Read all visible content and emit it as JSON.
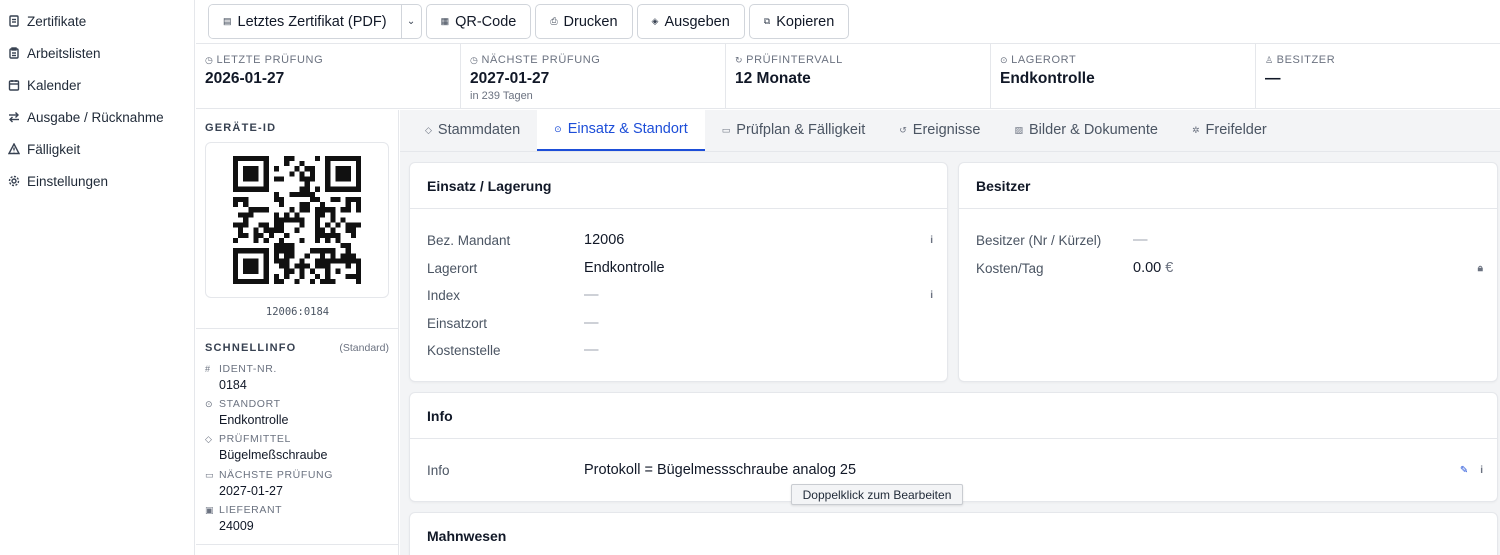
{
  "sidebar": {
    "items": [
      {
        "label": "Zertifikate",
        "icon": "document-icon"
      },
      {
        "label": "Arbeitslisten",
        "icon": "clipboard-icon"
      },
      {
        "label": "Kalender",
        "icon": "calendar-icon"
      },
      {
        "label": "Ausgabe / Rücknahme",
        "icon": "arrows-icon"
      },
      {
        "label": "Fälligkeit",
        "icon": "warning-icon"
      },
      {
        "label": "Einstellungen",
        "icon": "gear-icon"
      }
    ]
  },
  "toolbar": {
    "certificate_label": "Letztes Zertifikat (PDF)",
    "qr_label": "QR-Code",
    "print_label": "Drucken",
    "issue_label": "Ausgeben",
    "copy_label": "Kopieren"
  },
  "stats": [
    {
      "label": "LETZTE PRÜFUNG",
      "value": "2026-01-27",
      "sub": ""
    },
    {
      "label": "NÄCHSTE PRÜFUNG",
      "value": "2027-01-27",
      "sub": "in 239 Tagen"
    },
    {
      "label": "PRÜFINTERVALL",
      "value": "12 Monate",
      "sub": ""
    },
    {
      "label": "LAGERORT",
      "value": "Endkontrolle",
      "sub": ""
    },
    {
      "label": "BESITZER",
      "value": "—",
      "sub": ""
    }
  ],
  "device": {
    "heading": "GERÄTE-ID",
    "qr_text": "12006:0184"
  },
  "quickinfo": {
    "heading": "SCHNELLINFO",
    "mode": "(Standard)",
    "items": [
      {
        "label": "IDENT-NR.",
        "value": "0184",
        "icon": "hash-icon"
      },
      {
        "label": "STANDORT",
        "value": "Endkontrolle",
        "icon": "pin-icon"
      },
      {
        "label": "PRÜFMITTEL",
        "value": "Bügelmeßschraube",
        "icon": "tag-icon"
      },
      {
        "label": "NÄCHSTE PRÜFUNG",
        "value": "2027-01-27",
        "icon": "calendar-icon"
      },
      {
        "label": "LIEFERANT",
        "value": "24009",
        "icon": "box-icon"
      }
    ]
  },
  "tabs": [
    {
      "label": "Stammdaten",
      "active": false
    },
    {
      "label": "Einsatz & Standort",
      "active": true
    },
    {
      "label": "Prüfplan & Fälligkeit",
      "active": false
    },
    {
      "label": "Ereignisse",
      "active": false
    },
    {
      "label": "Bilder & Dokumente",
      "active": false
    },
    {
      "label": "Freifelder",
      "active": false
    }
  ],
  "einsatz": {
    "title": "Einsatz / Lagerung",
    "rows": [
      {
        "label": "Bez. Mandant",
        "value": "12006"
      },
      {
        "label": "Lagerort",
        "value": "Endkontrolle"
      },
      {
        "label": "Index",
        "value": "—"
      },
      {
        "label": "Einsatzort",
        "value": "—"
      },
      {
        "label": "Kostenstelle",
        "value": "—"
      }
    ]
  },
  "besitzer": {
    "title": "Besitzer",
    "rows": [
      {
        "label": "Besitzer (Nr / Kürzel)",
        "value": "—"
      },
      {
        "label": "Kosten/Tag",
        "value": "0.00",
        "unit": "€"
      }
    ]
  },
  "info": {
    "title": "Info",
    "label": "Info",
    "value": "Protokoll = Bügelmessschraube analog 25",
    "tooltip": "Doppelklick zum Bearbeiten"
  },
  "mahnwesen": {
    "title": "Mahnwesen"
  },
  "colors": {
    "accent": "#1d4ed8",
    "border": "#e5e7eb",
    "background": "#f3f4f6"
  }
}
